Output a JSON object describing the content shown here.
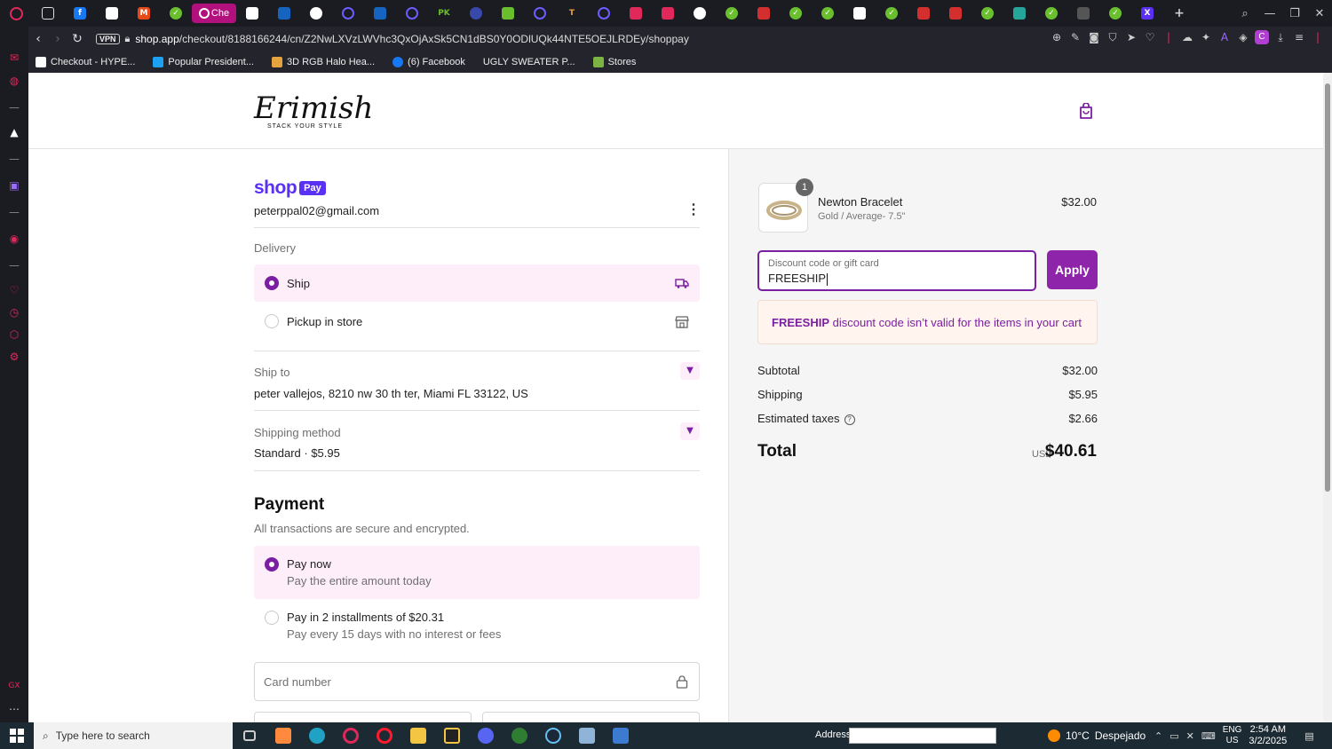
{
  "browser": {
    "active_tab_label": "Che",
    "url_host": "shop.app",
    "url_path": "/checkout/8188166244/cn/Z2NwLXVzLWVhc3QxOjAxSk5CN1dBS0Y0ODlUQk44NTE5OEJLRDEy/shoppay",
    "vpn_label": "VPN",
    "profile_letter": "C",
    "bookmarks": [
      {
        "label": "Checkout - HYPE...",
        "color": "#ffffff"
      },
      {
        "label": "Popular President...",
        "color": "#1da1f2"
      },
      {
        "label": "3D RGB Halo Hea...",
        "color": "#e6a23c"
      },
      {
        "label": "(6) Facebook",
        "color": "#1877f2"
      },
      {
        "label": "UGLY SWEATER P...",
        "color": "#24242c"
      },
      {
        "label": "Stores",
        "color": "#7cb342"
      }
    ]
  },
  "store": {
    "logo": "Erimish",
    "tagline": "STACK YOUR STYLE"
  },
  "checkout": {
    "shoppay_shop": "shop",
    "shoppay_pay": "Pay",
    "email": "peterppal02@gmail.com",
    "delivery_label": "Delivery",
    "delivery_options": [
      {
        "label": "Ship",
        "selected": true,
        "icon": "truck-icon"
      },
      {
        "label": "Pickup in store",
        "selected": false,
        "icon": "store-icon"
      }
    ],
    "ship_to_label": "Ship to",
    "ship_to_value": "peter vallejos, 8210 nw 30 th ter, Miami FL 33122, US",
    "shipping_method_label": "Shipping method",
    "shipping_method_value": "Standard · $5.95",
    "payment_title": "Payment",
    "payment_subtitle": "All transactions are secure and encrypted.",
    "payment_options": [
      {
        "label": "Pay now",
        "sub": "Pay the entire amount today",
        "selected": true
      },
      {
        "label": "Pay in 2 installments of $20.31",
        "sub": "Pay every 15 days with no interest or fees",
        "selected": false
      }
    ],
    "card_placeholder": "Card number"
  },
  "summary": {
    "item_name": "Newton Bracelet",
    "item_variant": "Gold / Average- 7.5\"",
    "item_price": "$32.00",
    "item_qty": "1",
    "discount_label": "Discount code or gift card",
    "discount_value": "FREESHIP",
    "apply_label": "Apply",
    "error_code": "FREESHIP",
    "error_text": " discount code isn’t valid for the items in your cart",
    "subtotal_label": "Subtotal",
    "subtotal_value": "$32.00",
    "shipping_label": "Shipping",
    "shipping_value": "$5.95",
    "taxes_label": "Estimated taxes",
    "taxes_value": "$2.66",
    "total_label": "Total",
    "total_currency": "USD",
    "total_value": "$40.61"
  },
  "taskbar": {
    "search_placeholder": "Type here to search",
    "address_label": "Address",
    "weather_temp": "10°C",
    "weather_text": "Despejado",
    "lang_1": "ENG",
    "lang_2": "US",
    "time": "2:54 AM",
    "date": "3/2/2025"
  },
  "colors": {
    "accent": "#7b1fa2",
    "shoppay": "#5a31f4",
    "selected_bg": "#fdeefa",
    "error_bg": "#fff4ee"
  }
}
